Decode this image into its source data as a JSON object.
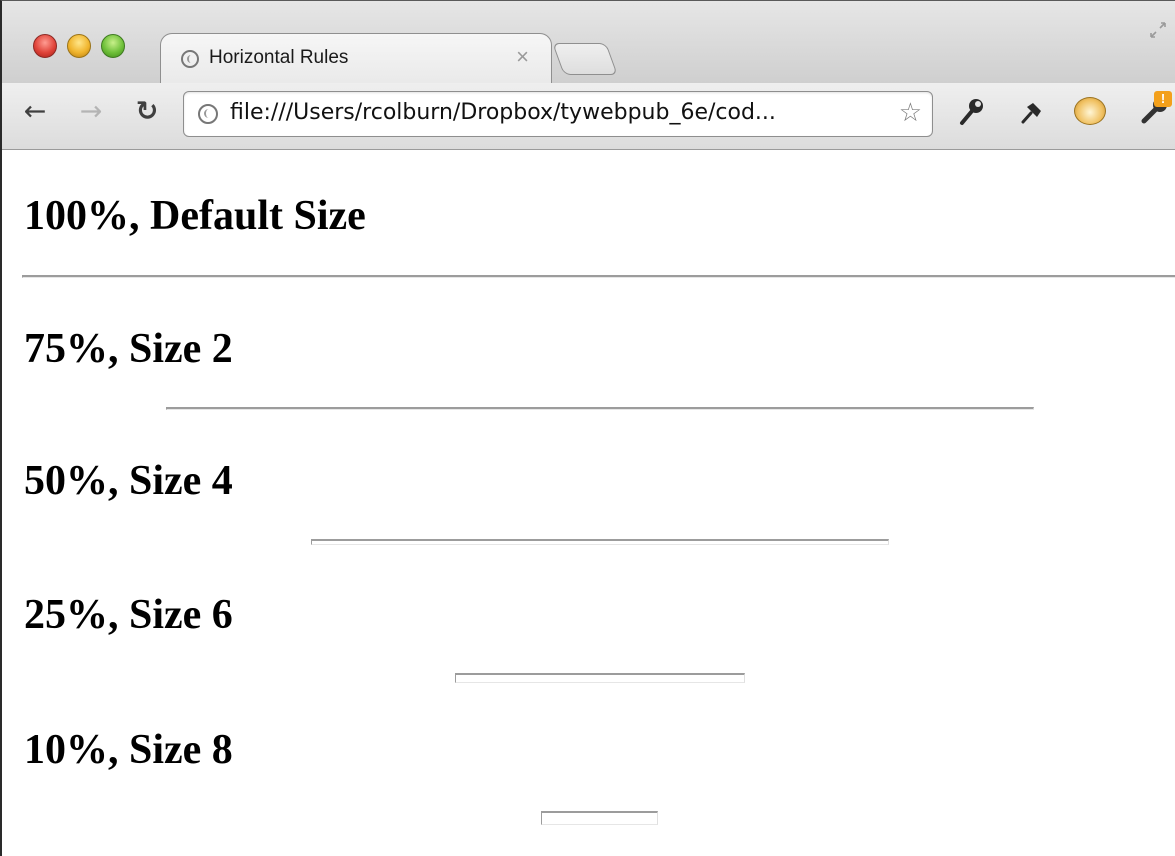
{
  "browser": {
    "tab_title": "Horizontal Rules",
    "tab_close_glyph": "×",
    "url": "file:///Users/rcolburn/Dropbox/tywebpub_6e/cod...",
    "icons": {
      "back": "back-arrow-icon",
      "forward": "forward-arrow-icon",
      "reload": "reload-icon",
      "bookmark": "star-icon",
      "wrench": "wrench-icon",
      "pin": "pin-icon",
      "extension": "extension-icon",
      "settings": "settings-wrench-icon"
    },
    "update_badge": "!"
  },
  "page": {
    "sections": [
      {
        "heading": "100%, Default Size",
        "rule_width_percent": 100,
        "rule_size": "default"
      },
      {
        "heading": "75%, Size 2",
        "rule_width_percent": 75,
        "rule_size": 2
      },
      {
        "heading": "50%, Size 4",
        "rule_width_percent": 50,
        "rule_size": 4
      },
      {
        "heading": "25%, Size 6",
        "rule_width_percent": 25,
        "rule_size": 6
      },
      {
        "heading": "10%, Size 8",
        "rule_width_percent": 10,
        "rule_size": 8
      }
    ]
  },
  "colors": {
    "rule": "#9c9c9c",
    "text": "#000000",
    "chrome_bg": "#dcdcdc"
  }
}
